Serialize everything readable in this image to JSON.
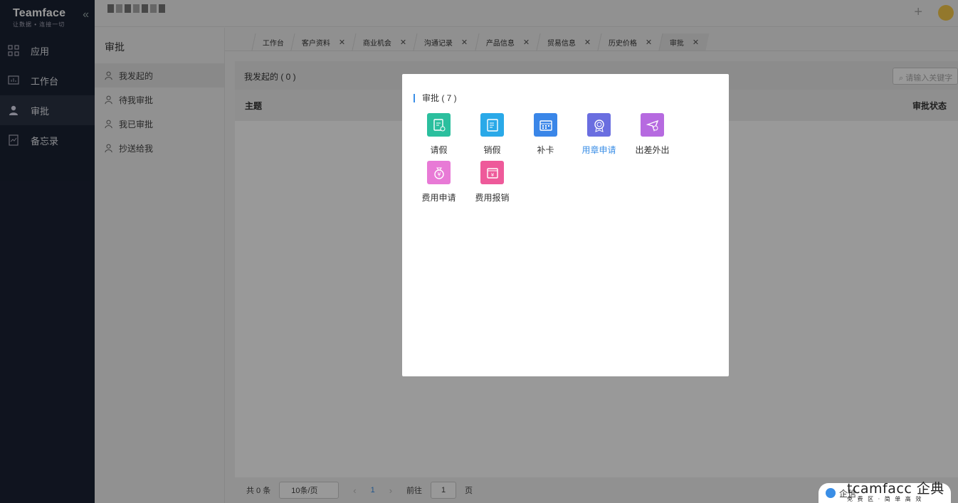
{
  "brand": {
    "name": "Teamface",
    "slogan": "让数据 • 连接一切"
  },
  "sidebar": {
    "items": [
      {
        "label": "应用",
        "icon": "apps-icon"
      },
      {
        "label": "工作台",
        "icon": "dashboard-icon"
      },
      {
        "label": "审批",
        "icon": "user-icon"
      },
      {
        "label": "备忘录",
        "icon": "memo-icon"
      }
    ],
    "active_index": 2
  },
  "submenu": {
    "title": "审批",
    "items": [
      "我发起的",
      "待我审批",
      "我已审批",
      "抄送给我"
    ]
  },
  "tabs": [
    {
      "label": "工作台",
      "closable": false
    },
    {
      "label": "客户资料",
      "closable": true
    },
    {
      "label": "商业机会",
      "closable": true
    },
    {
      "label": "沟通记录",
      "closable": true
    },
    {
      "label": "产品信息",
      "closable": true
    },
    {
      "label": "贸易信息",
      "closable": true
    },
    {
      "label": "历史价格",
      "closable": true
    },
    {
      "label": "审批",
      "closable": true
    }
  ],
  "main": {
    "list_title": "我发起的 ( 0 )",
    "search_placeholder": "请输入关键字",
    "col_subject": "主题",
    "col_status": "审批状态"
  },
  "pager": {
    "total": "共 0 条",
    "page_size": "10条/页",
    "current_page": "1",
    "goto_label": "前往",
    "goto_value": "1",
    "page_unit": "页"
  },
  "modal": {
    "title": "审批 ( 7 )",
    "items": [
      {
        "label": "请假",
        "color": "#2bbf9e",
        "icon": "leave-icon"
      },
      {
        "label": "销假",
        "color": "#2aa9e8",
        "icon": "cancel-leave-icon"
      },
      {
        "label": "补卡",
        "color": "#3a86e8",
        "icon": "calendar-icon"
      },
      {
        "label": "用章申请",
        "color": "#6a6ee0",
        "icon": "seal-icon",
        "highlight": true
      },
      {
        "label": "出差外出",
        "color": "#b66ae0",
        "icon": "plane-icon"
      },
      {
        "label": "费用申请",
        "color": "#e87ad6",
        "icon": "money-bag-icon"
      },
      {
        "label": "费用报销",
        "color": "#ee5a9a",
        "icon": "reimburse-icon"
      }
    ]
  },
  "chat_widget": {
    "label": "企信"
  },
  "watermark": {
    "big": "tcamfacc 企典",
    "small": "免 费 区 · 简 单 高 效"
  }
}
